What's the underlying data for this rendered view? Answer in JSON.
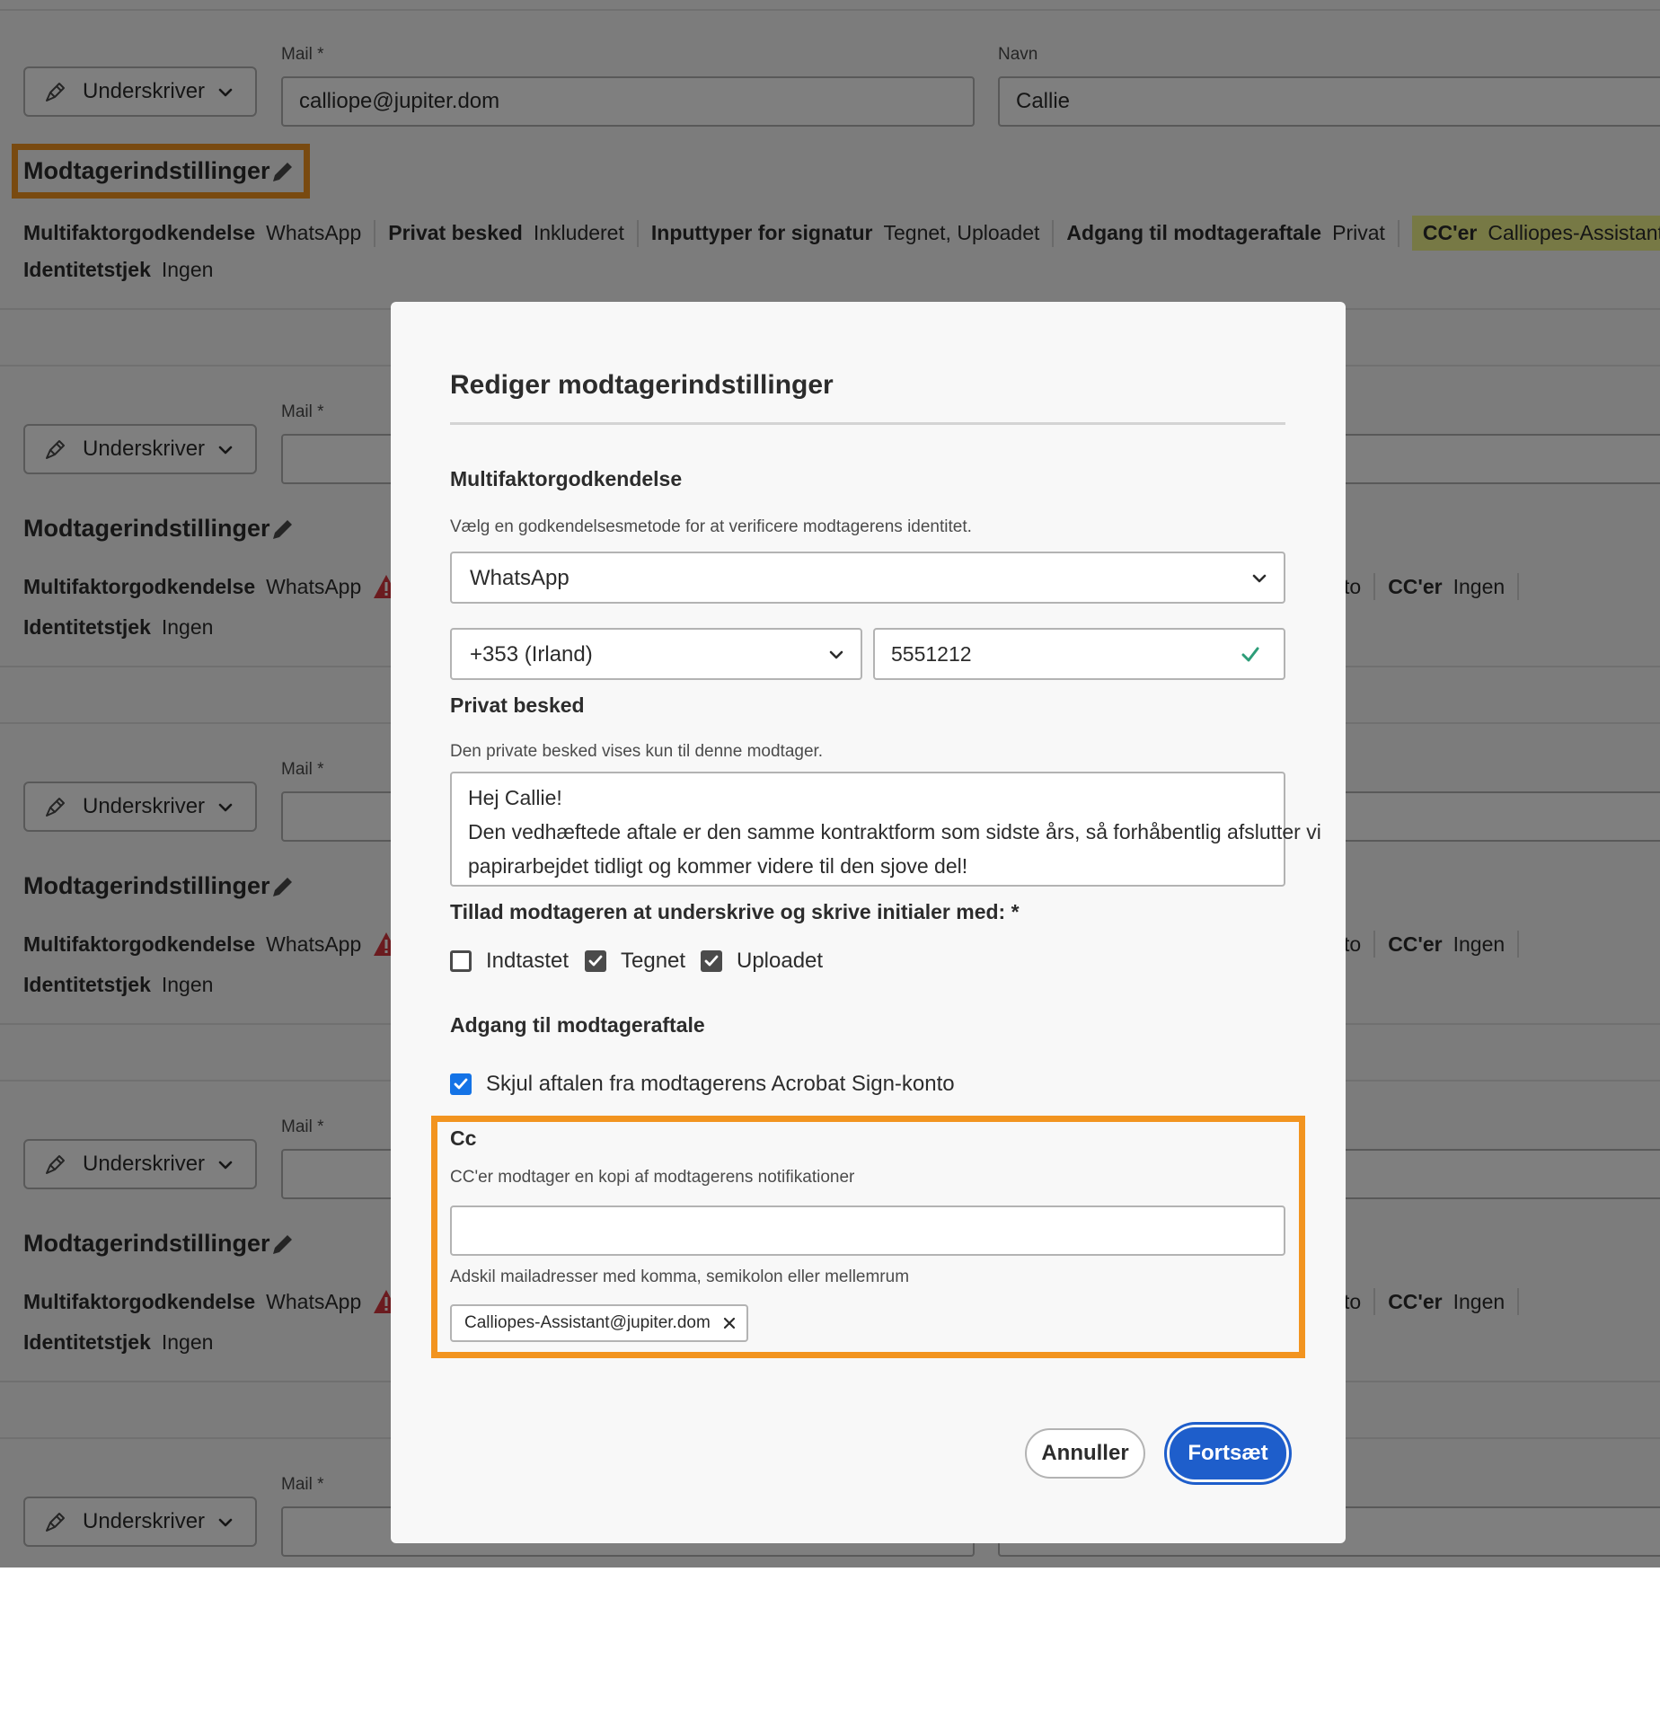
{
  "background": {
    "role_label": "Underskriver",
    "mail_label": "Mail",
    "name_label": "Navn",
    "required_mark": "*",
    "first_recipient": {
      "mail_value": "calliope@jupiter.dom",
      "name_value": "Callie",
      "settings_title": "Modtagerindstillinger",
      "summary": {
        "mfa_key": "Multifaktorgodkendelse",
        "mfa_value": "WhatsApp",
        "private_key": "Privat besked",
        "private_value": "Inkluderet",
        "input_key": "Inputtyper for signatur",
        "input_value": "Tegnet, Uploadet",
        "access_key": "Adgang til modtageraftale",
        "access_value": "Privat",
        "cc_key": "CC'er",
        "cc_value": "Calliopes-Assistant@jupiter.dom",
        "identity_key": "Identitetstjek",
        "identity_value": "Ingen"
      }
    },
    "other_recipients": {
      "settings_title": "Modtagerindstillinger",
      "mfa_key": "Multifaktorgodkendelse",
      "mfa_value": "WhatsApp",
      "identity_key": "Identitetstjek",
      "identity_value": "Ingen",
      "access_tail": "to",
      "cc_key": "CC'er",
      "cc_value": "Ingen"
    }
  },
  "dialog": {
    "title": "Rediger modtagerindstillinger",
    "mfa": {
      "heading": "Multifaktorgodkendelse",
      "help": "Vælg en godkendelsesmetode for at verificere modtagerens identitet.",
      "method": "WhatsApp",
      "country": "+353 (Irland)",
      "phone": "5551212"
    },
    "private_message": {
      "heading": "Privat besked",
      "help": "Den private besked vises kun til denne modtager.",
      "line1": "Hej Callie!",
      "line2": "Den vedhæftede aftale er den samme kontraktform som sidste års, så forhåbentlig afslutter vi",
      "line3": "papirarbejdet tidligt og kommer videre til den sjove del!"
    },
    "signature_types": {
      "heading": "Tillad modtageren at underskrive og skrive initialer med: *",
      "options": [
        {
          "label": "Indtastet",
          "checked": false
        },
        {
          "label": "Tegnet",
          "checked": true
        },
        {
          "label": "Uploadet",
          "checked": true
        }
      ]
    },
    "access": {
      "heading": "Adgang til modtageraftale",
      "checkbox_label": "Skjul aftalen fra modtagerens Acrobat Sign-konto",
      "checked": true
    },
    "cc": {
      "heading": "Cc",
      "help": "CC'er modtager en kopi af modtagerens notifikationer",
      "input_value": "",
      "hint": "Adskil mailadresser med komma, semikolon eller mellemrum",
      "chip": "Calliopes-Assistant@jupiter.dom"
    },
    "cancel_label": "Annuller",
    "continue_label": "Fortsæt"
  },
  "colors": {
    "highlight_orange": "#f29420",
    "cc_highlight": "#eef28a",
    "primary_blue": "#1e5ecb",
    "warning_red": "#d7373f",
    "valid_green": "#2d9d78",
    "checkbox_blue": "#1473e6"
  },
  "icons": [
    "pen-icon",
    "chevron-down-icon",
    "pencil-icon",
    "warning-icon",
    "checkmark-icon",
    "close-icon"
  ]
}
